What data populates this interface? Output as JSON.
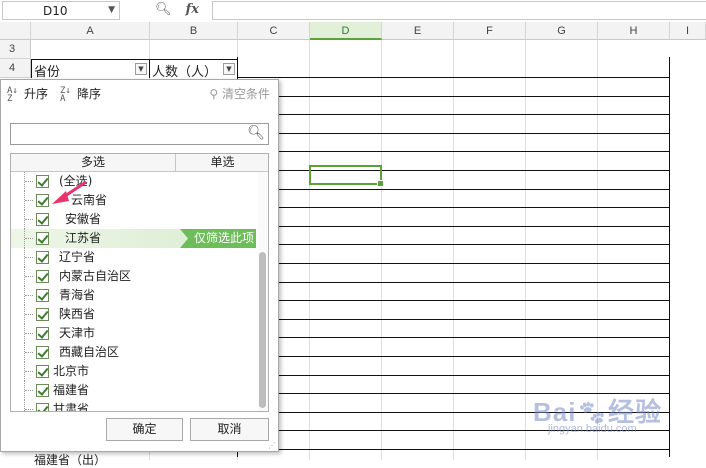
{
  "formula_bar": {
    "cell_ref": "D10",
    "fx_label": "fx",
    "zoom_icon": "search-zoom-icon",
    "formula": ""
  },
  "columns": [
    "A",
    "B",
    "C",
    "D",
    "E",
    "F",
    "G",
    "H",
    "I"
  ],
  "active_column": "D",
  "rows": [
    "3",
    "4"
  ],
  "cells": {
    "A4": "省份",
    "B4": "人数（人）",
    "C_bottom": "福建省（出）"
  },
  "filter_panel": {
    "sort_asc": "升序",
    "sort_desc": "降序",
    "clear": "清空条件",
    "search_placeholder": "",
    "tabs": [
      "多选",
      "单选"
    ],
    "items": [
      {
        "label": "(全选)",
        "checked": true
      },
      {
        "label": "云南省",
        "checked": true
      },
      {
        "label": "安徽省",
        "checked": true
      },
      {
        "label": "江苏省",
        "checked": true
      },
      {
        "label": "辽宁省",
        "checked": true
      },
      {
        "label": "内蒙古自治区",
        "checked": true
      },
      {
        "label": "青海省",
        "checked": true
      },
      {
        "label": "陕西省",
        "checked": true
      },
      {
        "label": "天津市",
        "checked": true
      },
      {
        "label": "西藏自治区",
        "checked": true
      },
      {
        "label": "北京市",
        "checked": true
      },
      {
        "label": "福建省",
        "checked": true
      },
      {
        "label": "甘肃省",
        "checked": true
      }
    ],
    "only_this": "仅筛选此项",
    "ok": "确定",
    "cancel": "取消"
  },
  "watermark": {
    "main": "Bai",
    "accent": "经验",
    "sub": "jingyan.baidu.com"
  },
  "colors": {
    "accent_green": "#5aa339",
    "tag_green": "#6dbd5a",
    "arrow": "#e8356d"
  }
}
